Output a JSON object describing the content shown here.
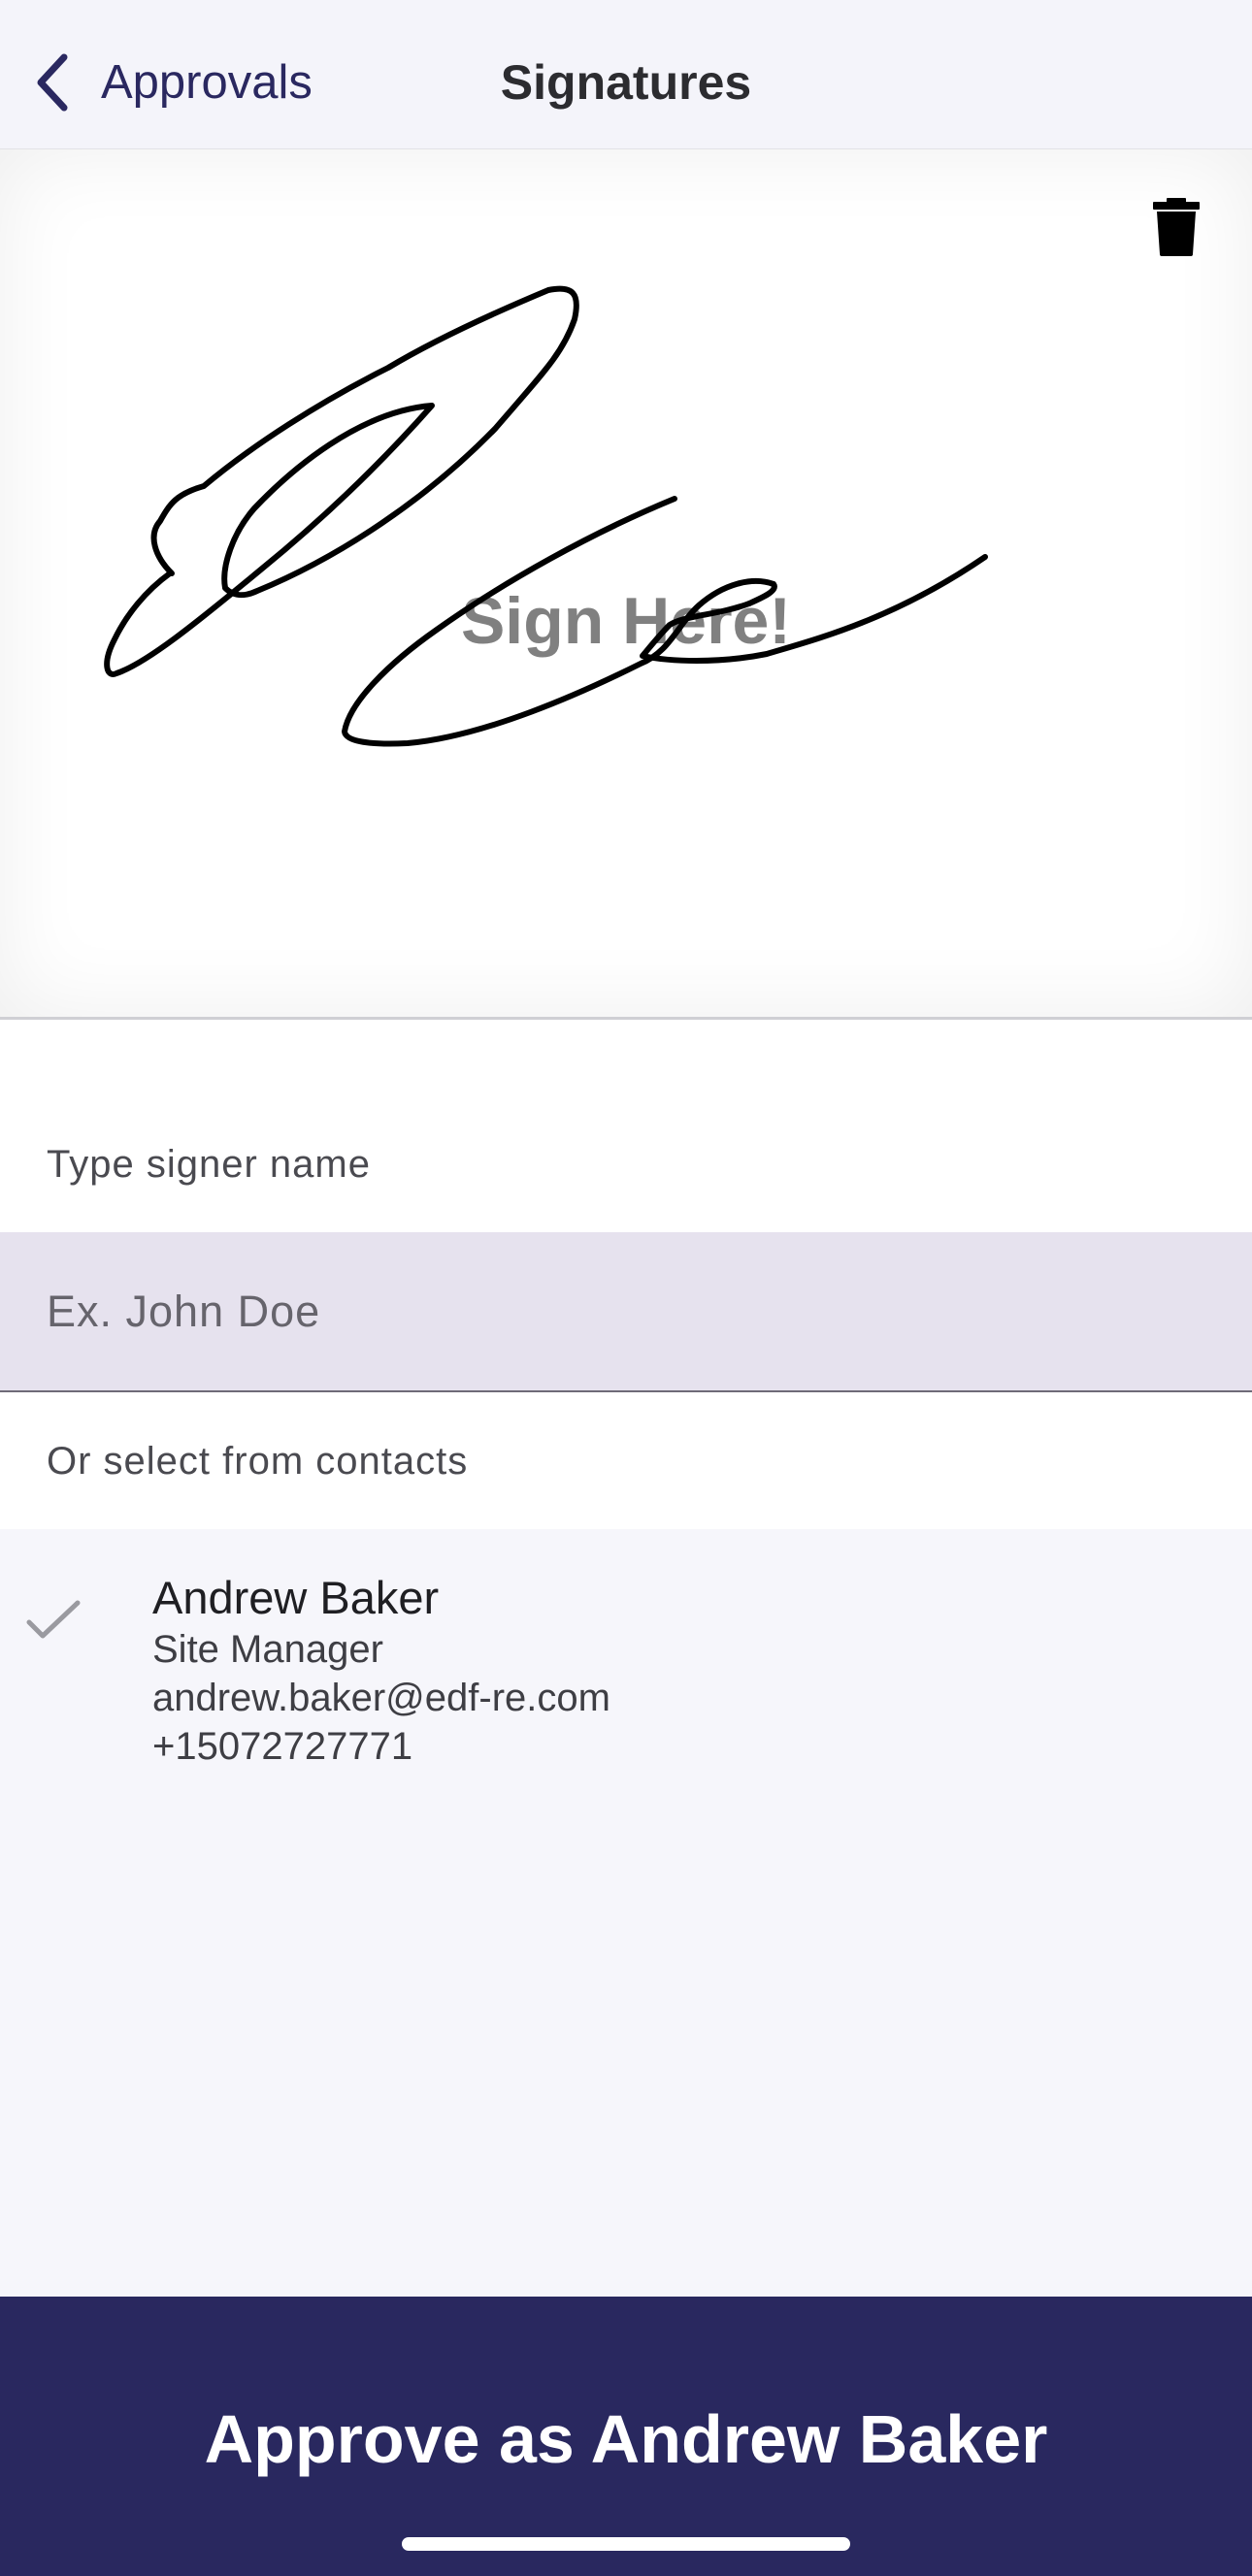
{
  "nav": {
    "back_label": "Approvals",
    "title": "Signatures"
  },
  "signature_pad": {
    "prompt": "Sign Here!",
    "has_signature": true
  },
  "signer": {
    "label": "Type signer name",
    "placeholder": "Ex. John Doe",
    "value": ""
  },
  "contacts": {
    "label": "Or select from contacts",
    "items": [
      {
        "name": "Andrew Baker",
        "role": "Site Manager",
        "email": "andrew.baker@edf-re.com",
        "phone": "+15072727771",
        "selected": true
      }
    ]
  },
  "approve": {
    "label": "Approve as Andrew Baker"
  },
  "colors": {
    "brand": "#29285f",
    "input_bg": "#e6e2ee",
    "page_bg": "#f6f6fb"
  },
  "icons": {
    "back": "chevron-left-icon",
    "delete": "trash-icon",
    "selected": "checkmark-icon"
  }
}
